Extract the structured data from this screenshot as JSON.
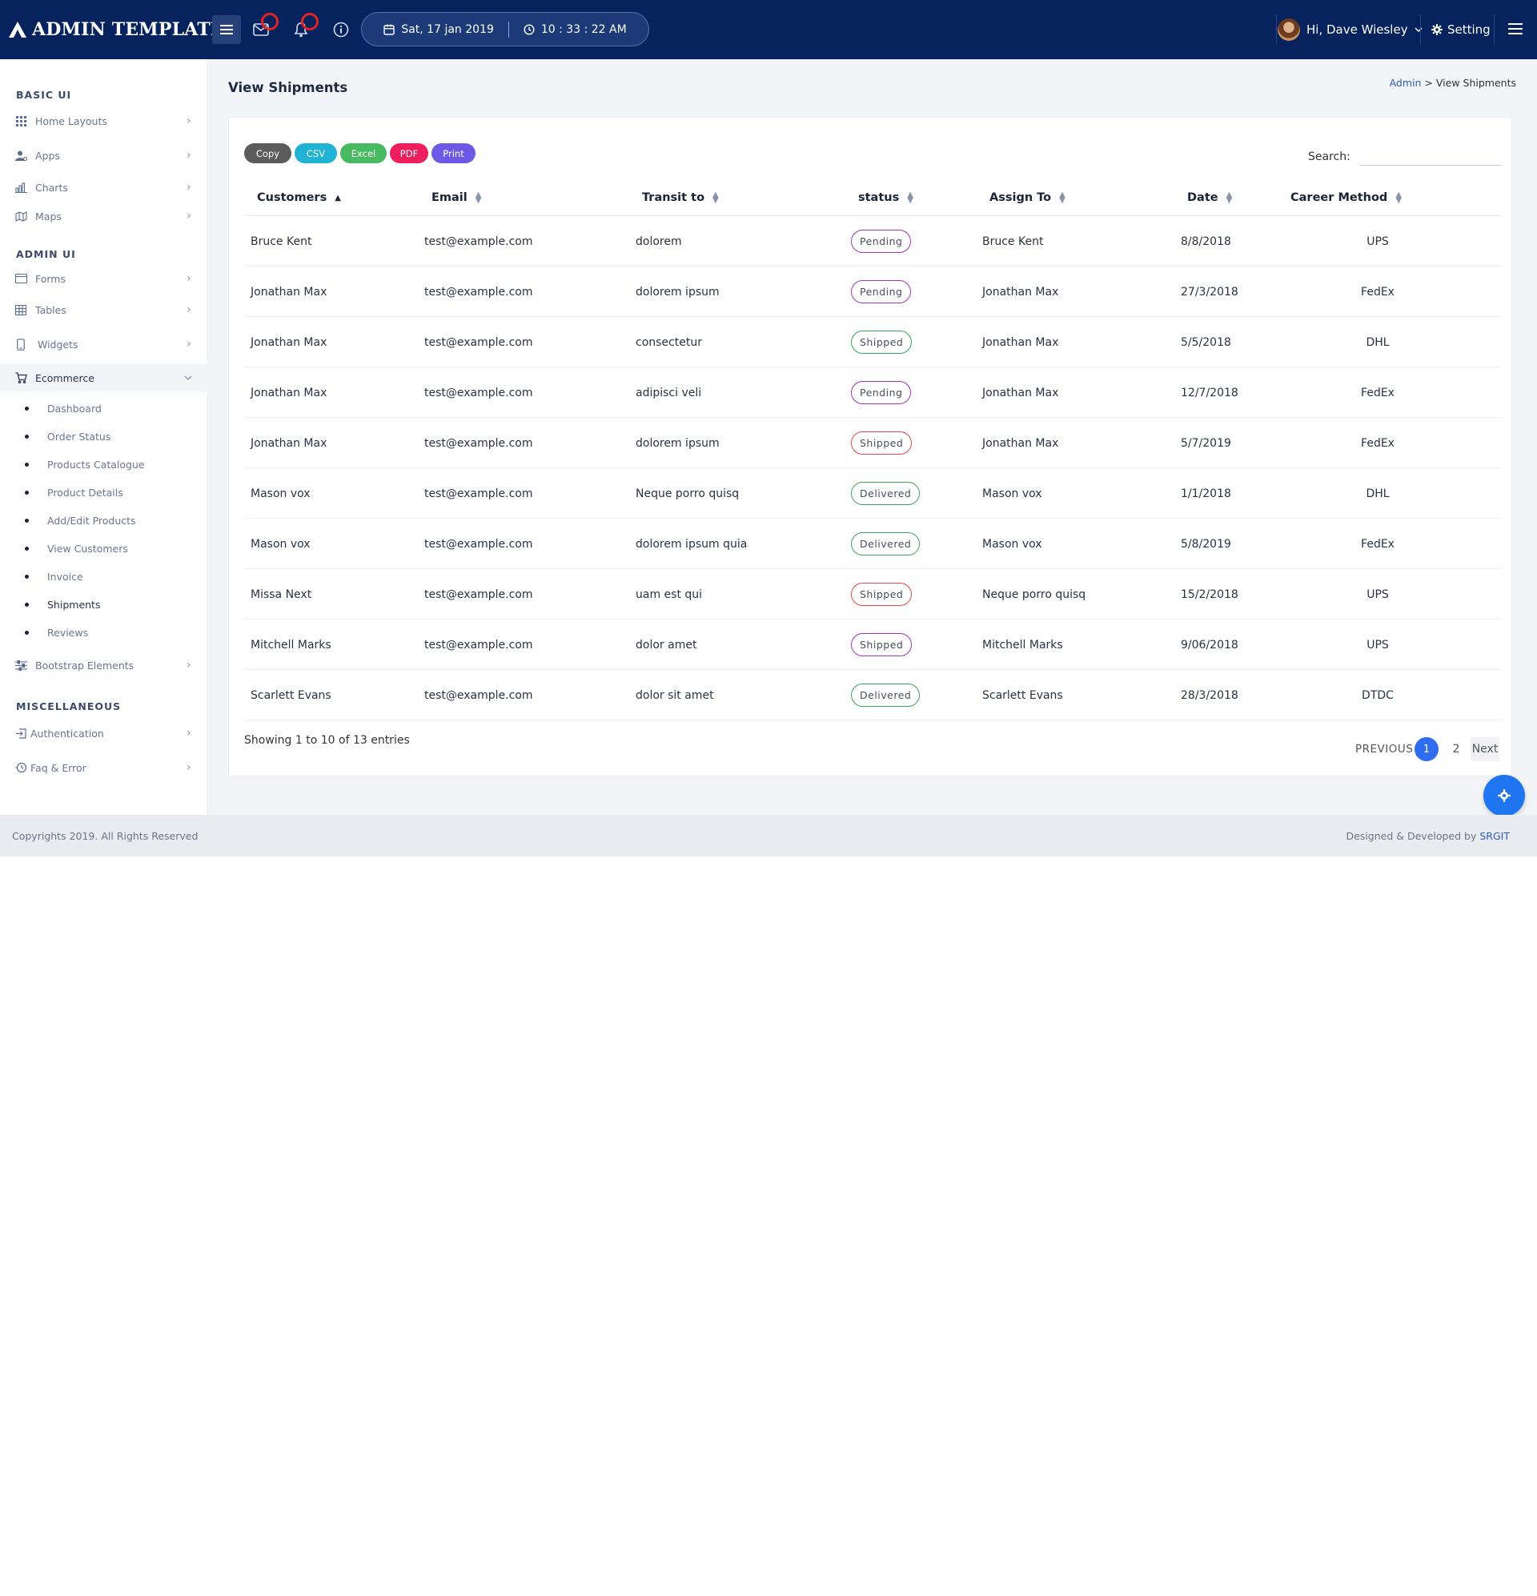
{
  "header": {
    "brand": "ADMIN TEMPLATE",
    "date": "Sat, 17 jan 2019",
    "time": "10 : 33 : 22 AM",
    "user_greeting": "Hi, Dave Wiesley",
    "setting_label": "Setting"
  },
  "sidebar": {
    "sections": {
      "basic_ui": "BASIC UI",
      "admin_ui": "ADMIN UI",
      "misc": "MISCELLANEOUS"
    },
    "items": {
      "home_layouts": "Home Layouts",
      "apps": "Apps",
      "charts": "Charts",
      "maps": "Maps",
      "forms": "Forms",
      "tables": "Tables",
      "widgets": "Widgets",
      "ecommerce": "Ecommerce",
      "bootstrap": "Bootstrap Elements",
      "authentication": "Authentication",
      "faq": "Faq & Error"
    },
    "ecommerce_sub": [
      "Dashboard",
      "Order Status",
      "Products Catalogue",
      "Product Details",
      "Add/Edit Products",
      "View Customers",
      "Invoice",
      "Shipments",
      "Reviews"
    ]
  },
  "page": {
    "title": "View Shipments",
    "breadcrumb_root": "Admin",
    "breadcrumb_sep": ">",
    "breadcrumb_current": "View Shipments"
  },
  "export_buttons": [
    "Copy",
    "CSV",
    "Excel",
    "PDF",
    "Print"
  ],
  "colors": {
    "topbar": "#07235e",
    "copy": "#5c5c5c",
    "csv": "#21b3d3",
    "excel": "#48bb62",
    "pdf": "#ee1f5f",
    "print": "#6c5ae6",
    "pending": "#a236b7",
    "shipped_green": "#3aa857",
    "shipped_red": "#e8474a",
    "delivered": "#3aa857",
    "primary": "#2f6cf0"
  },
  "search": {
    "label": "Search:",
    "value": ""
  },
  "table": {
    "columns": [
      "Customers",
      "Email",
      "Transit to",
      "status",
      "Assign To",
      "Date",
      "Career Method"
    ],
    "rows": [
      {
        "customer": "Bruce Kent",
        "email": "test@example.com",
        "transit": "dolorem",
        "status": "Pending",
        "status_color": "#a236b7",
        "assign": "Bruce Kent",
        "date": "8/8/2018",
        "method": "UPS"
      },
      {
        "customer": "Jonathan Max",
        "email": "test@example.com",
        "transit": "dolorem ipsum",
        "status": "Pending",
        "status_color": "#a236b7",
        "assign": "Jonathan Max",
        "date": "27/3/2018",
        "method": "FedEx"
      },
      {
        "customer": "Jonathan Max",
        "email": "test@example.com",
        "transit": "consectetur",
        "status": "Shipped",
        "status_color": "#3aa857",
        "assign": "Jonathan Max",
        "date": "5/5/2018",
        "method": "DHL"
      },
      {
        "customer": "Jonathan Max",
        "email": "test@example.com",
        "transit": "adipisci veli",
        "status": "Pending",
        "status_color": "#a236b7",
        "assign": "Jonathan Max",
        "date": "12/7/2018",
        "method": "FedEx"
      },
      {
        "customer": "Jonathan Max",
        "email": "test@example.com",
        "transit": "dolorem ipsum",
        "status": "Shipped",
        "status_color": "#e8474a",
        "assign": "Jonathan Max",
        "date": "5/7/2019",
        "method": "FedEx"
      },
      {
        "customer": "Mason vox",
        "email": "test@example.com",
        "transit": "Neque porro quisq",
        "status": "Delivered",
        "status_color": "#3aa857",
        "assign": "Mason vox",
        "date": "1/1/2018",
        "method": "DHL"
      },
      {
        "customer": "Mason vox",
        "email": "test@example.com",
        "transit": "dolorem ipsum quia",
        "status": "Delivered",
        "status_color": "#3aa857",
        "assign": "Mason vox",
        "date": "5/8/2019",
        "method": "FedEx"
      },
      {
        "customer": "Missa Next",
        "email": "test@example.com",
        "transit": "uam est qui",
        "status": "Shipped",
        "status_color": "#e8474a",
        "assign": "Neque porro quisq",
        "date": "15/2/2018",
        "method": "UPS"
      },
      {
        "customer": "Mitchell Marks",
        "email": "test@example.com",
        "transit": "dolor amet",
        "status": "Shipped",
        "status_color": "#a236b7",
        "assign": "Mitchell Marks",
        "date": "9/06/2018",
        "method": "UPS"
      },
      {
        "customer": "Scarlett Evans",
        "email": "test@example.com",
        "transit": "dolor sit amet",
        "status": "Delivered",
        "status_color": "#3aa857",
        "assign": "Scarlett Evans",
        "date": "28/3/2018",
        "method": "DTDC"
      }
    ]
  },
  "pagination": {
    "info": "Showing 1 to 10 of 13 entries",
    "previous": "PREVIOUS",
    "pages": [
      "1",
      "2"
    ],
    "next": "Next"
  },
  "footer": {
    "copyright": "Copyrights 2019. All Rights Reserved",
    "designed_by": "Designed & Developed by",
    "company": "SRGIT"
  }
}
